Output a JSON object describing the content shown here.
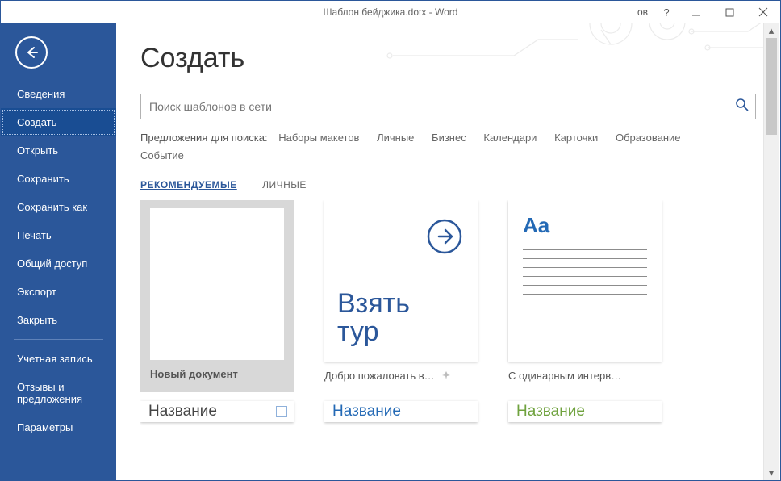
{
  "title": "Шаблон бейджика.dotx  -  Word",
  "user_suffix": "ов",
  "sidebar": {
    "items": [
      "Сведения",
      "Создать",
      "Открыть",
      "Сохранить",
      "Сохранить как",
      "Печать",
      "Общий доступ",
      "Экспорт",
      "Закрыть"
    ],
    "items2": [
      "Учетная запись",
      "Отзывы и предложения",
      "Параметры"
    ],
    "selected": 1
  },
  "page_heading": "Создать",
  "search_placeholder": "Поиск шаблонов в сети",
  "suggest_label": "Предложения для поиска:",
  "suggestions": [
    "Наборы макетов",
    "Личные",
    "Бизнес",
    "Календари",
    "Карточки",
    "Образование",
    "Событие"
  ],
  "tabs": {
    "featured": "РЕКОМЕНДУЕМЫЕ",
    "personal": "ЛИЧНЫЕ"
  },
  "cards": {
    "new_doc": "Новый документ",
    "tour_line1": "Взять",
    "tour_line2": "тур",
    "tour_caption": "Добро пожаловать в…",
    "spacing_caption": "С одинарным интерв…",
    "stub_a": "Название",
    "stub_b": "Название",
    "stub_c": "Название",
    "aa": "Aa"
  }
}
